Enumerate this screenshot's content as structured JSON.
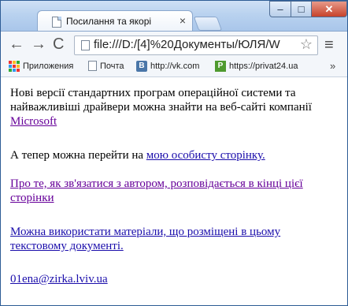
{
  "window": {
    "tab_title": "Посилання та якорі",
    "minimize_glyph": "–",
    "maximize_glyph": "□",
    "close_glyph": "✕",
    "tab_close_glyph": "×"
  },
  "toolbar": {
    "back_glyph": "←",
    "forward_glyph": "→",
    "reload_glyph": "C",
    "address": "file:///D:/[4]%20Документы/ЮЛЯ/W",
    "star_glyph": "☆",
    "menu_glyph": "≡"
  },
  "bookmarks": {
    "apps_label": "Приложения",
    "poshta_label": "Почта",
    "vk_label": "http://vk.com",
    "vk_icon_letter": "B",
    "privat_label": "https://privat24.ua",
    "privat_icon_letter": "P",
    "more_glyph": "»"
  },
  "content": {
    "p1_text": "Нові версії стандартних програм операційної системи та найважливіші драйвери можна знайти на веб-сайті компанії ",
    "p1_link": "Microsoft ",
    "p2_text": "А тепер можна перейти на ",
    "p2_link": "мою особисту сторінку.",
    "p3_link": "Про те, як зв'язатися з автором, розповідається в кінці цієї сторінки ",
    "p4_link": "Можна використати матеріали, що розміщені в цьому текстовому документі. ",
    "p5_link": "01ena@zirka.lviv.ua"
  },
  "colors": {
    "link": "#1a0dab",
    "visited_link": "#660099"
  }
}
